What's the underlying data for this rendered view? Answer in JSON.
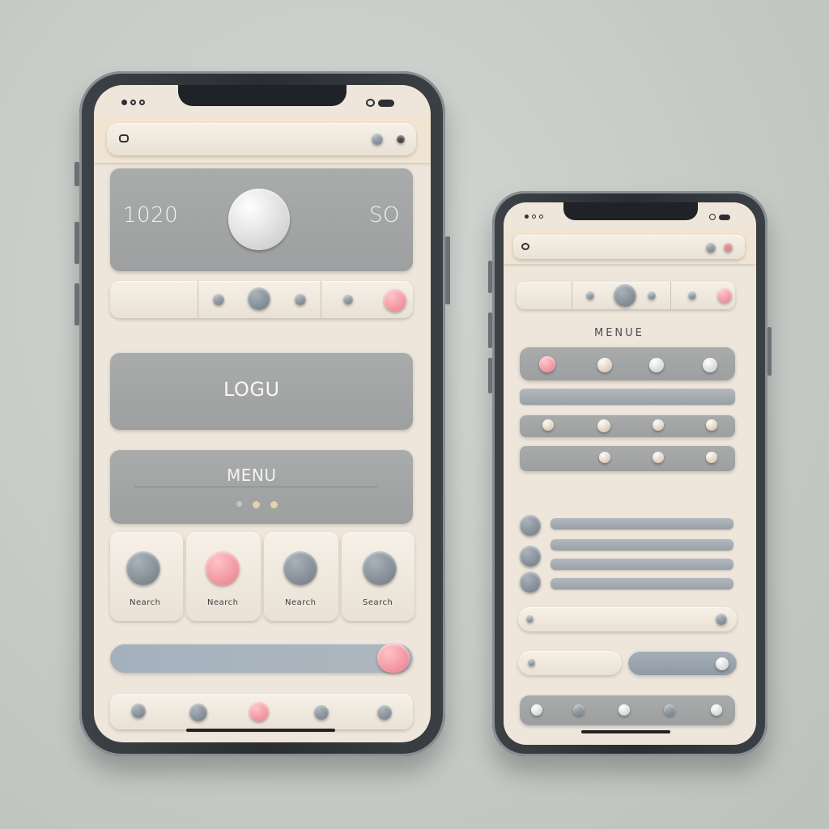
{
  "phone_left": {
    "status_left": "",
    "status_right_icons": [
      "signal-icon",
      "wifi-icon",
      "battery-icon"
    ],
    "top_bar": {
      "label_1": "",
      "label_2": ""
    },
    "card": {
      "left_value": "1020",
      "right_value": "SO",
      "left_caption": ""
    },
    "segment": {
      "label": ""
    },
    "logo_label": "LOGU",
    "menu": {
      "label": "MENU"
    },
    "tiles": [
      {
        "label": "Nearch"
      },
      {
        "label": "Nearch"
      },
      {
        "label": "Nearch"
      },
      {
        "label": "Search"
      }
    ],
    "search_bar": {
      "placeholder": "",
      "hint": ""
    }
  },
  "phone_right": {
    "status_left": "",
    "menu_title": "MENUE",
    "colors": {
      "accent": "#ea7b88",
      "screen": "#eee6db",
      "panel": "#a9acab"
    }
  }
}
